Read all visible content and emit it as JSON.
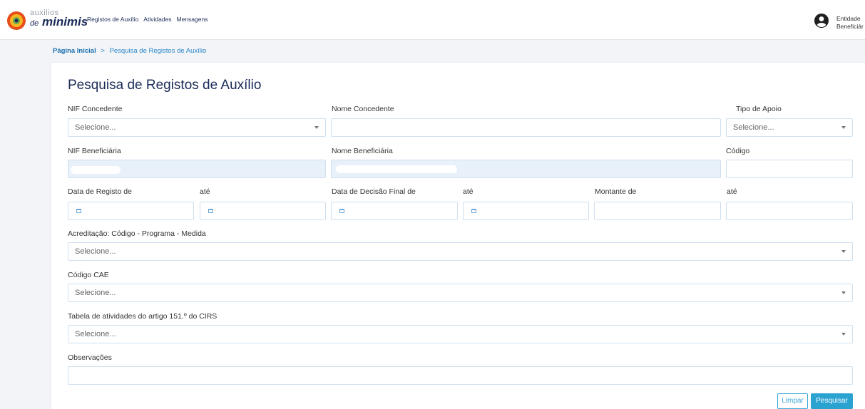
{
  "app": {
    "logo_top": "auxilios",
    "logo_de": "de",
    "logo_bottom": "minimis"
  },
  "nav": {
    "items": [
      "Registos de Auxílio",
      "Atividades",
      "Mensagens"
    ]
  },
  "user": {
    "line1": "Entidade",
    "line2": "Beneficiár"
  },
  "breadcrumb": {
    "home": "Página Inicial",
    "separator": ">",
    "current": "Pesquisa de Registos de Auxílio"
  },
  "form": {
    "title": "Pesquisa de Registos de Auxílio",
    "nif_concedente": {
      "label": "NIF Concedente",
      "placeholder": "Selecione..."
    },
    "nome_concedente": {
      "label": "Nome Concedente",
      "value": ""
    },
    "tipo_apoio": {
      "label": "Tipo de Apoio",
      "placeholder": "Selecione..."
    },
    "nif_beneficiaria": {
      "label": "NIF Beneficiária"
    },
    "nome_beneficiaria": {
      "label": "Nome Beneficiária"
    },
    "codigo": {
      "label": "Código",
      "value": ""
    },
    "data_registo_de": {
      "label": "Data de Registo de"
    },
    "data_registo_ate": {
      "label": "até"
    },
    "data_decisao_de": {
      "label": "Data de Decisão Final de"
    },
    "data_decisao_ate": {
      "label": "até"
    },
    "montante_de": {
      "label": "Montante de",
      "value": ""
    },
    "montante_ate": {
      "label": "até",
      "value": ""
    },
    "acreditacao": {
      "label": "Acreditação: Código - Programa - Medida",
      "placeholder": "Selecione..."
    },
    "codigo_cae": {
      "label": "Código CAE",
      "placeholder": "Selecione..."
    },
    "tabela_atividades": {
      "label": "Tabela de atividades do artigo 151.º do CIRS",
      "placeholder": "Selecione..."
    },
    "observacoes": {
      "label": "Observações",
      "value": ""
    }
  },
  "buttons": {
    "clear": "Limpar",
    "search": "Pesquisar"
  },
  "colors": {
    "brand_navy": "#1b2b57",
    "accent_blue": "#2ba3d1",
    "field_border": "#cfe0f0",
    "readonly_bg": "#e8f0f9"
  }
}
